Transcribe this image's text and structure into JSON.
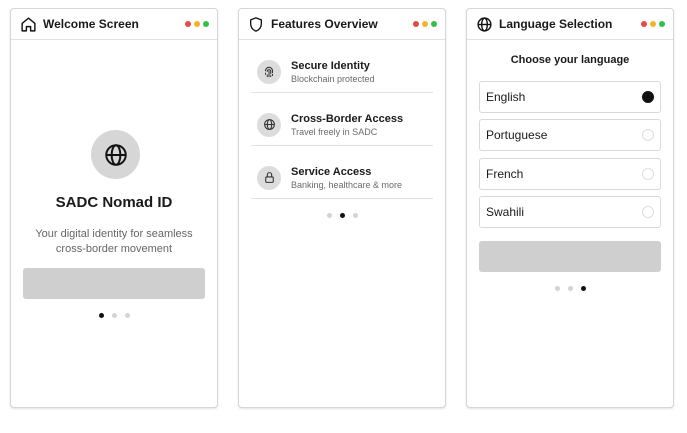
{
  "colors": {
    "window_red": "#e34b44",
    "window_yellow": "#f0b52a",
    "window_green": "#33c04f",
    "button_gray": "#cfcfcf",
    "active_dot": "#111111"
  },
  "cards": {
    "welcome": {
      "title": "Welcome Screen",
      "icon": "home-icon",
      "app_name": "SADC Nomad ID",
      "subtitle": "Your digital identity for seamless cross-border movement",
      "hero_icon": "globe-icon",
      "pager_active": 1
    },
    "features": {
      "title": "Features Overview",
      "icon": "shield-icon",
      "items": [
        {
          "title": "Secure Identity",
          "subtitle": "Blockchain protected",
          "icon": "fingerprint-icon"
        },
        {
          "title": "Cross-Border Access",
          "subtitle": "Travel freely in SADC",
          "icon": "globe-icon"
        },
        {
          "title": "Service Access",
          "subtitle": "Banking, healthcare & more",
          "icon": "lock-icon"
        }
      ],
      "pager_active": 2
    },
    "language": {
      "title": "Language Selection",
      "icon": "globe-icon",
      "heading": "Choose your language",
      "options": [
        {
          "label": "English",
          "selected": true
        },
        {
          "label": "Portuguese",
          "selected": false
        },
        {
          "label": "French",
          "selected": false
        },
        {
          "label": "Swahili",
          "selected": false
        }
      ],
      "pager_active": 3
    }
  }
}
